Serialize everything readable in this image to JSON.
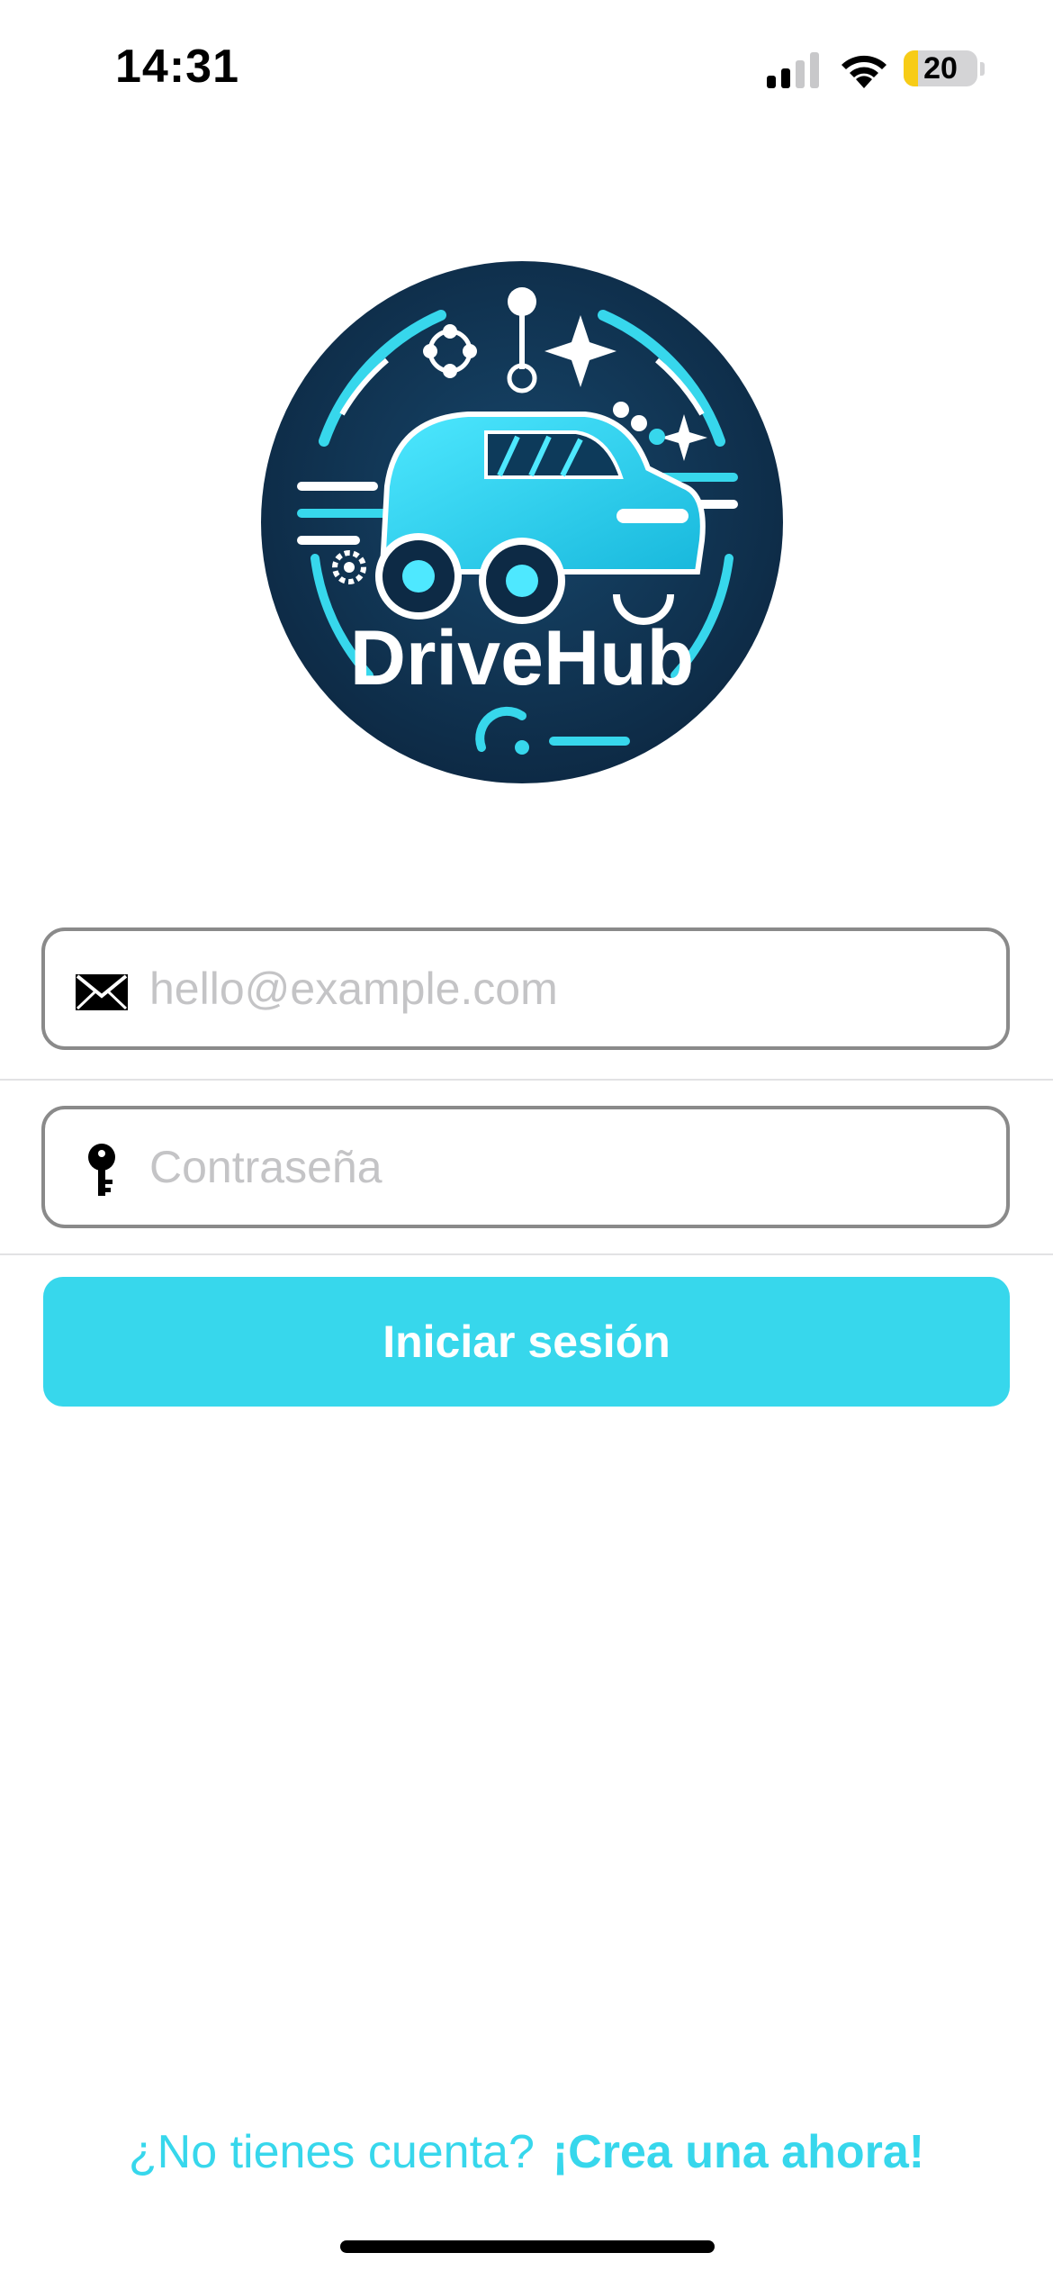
{
  "status_bar": {
    "time": "14:31",
    "battery_level": "20",
    "icons": [
      "signal-icon",
      "wifi-icon",
      "battery-icon"
    ]
  },
  "logo": {
    "text": "DriveHub",
    "icon": "car-logo-icon"
  },
  "login_form": {
    "email": {
      "placeholder": "hello@example.com",
      "value": "",
      "icon": "envelope-icon"
    },
    "password": {
      "placeholder": "Contraseña",
      "value": "",
      "icon": "key-icon"
    },
    "submit_label": "Iniciar sesión"
  },
  "footer": {
    "prompt": "¿No tienes cuenta?",
    "link_label": "¡Crea una ahora!"
  },
  "colors": {
    "accent": "#37d7ec",
    "field_border": "#8a8a8a",
    "placeholder": "#c4c4c6",
    "logo_dark": "#0f2f4a"
  }
}
